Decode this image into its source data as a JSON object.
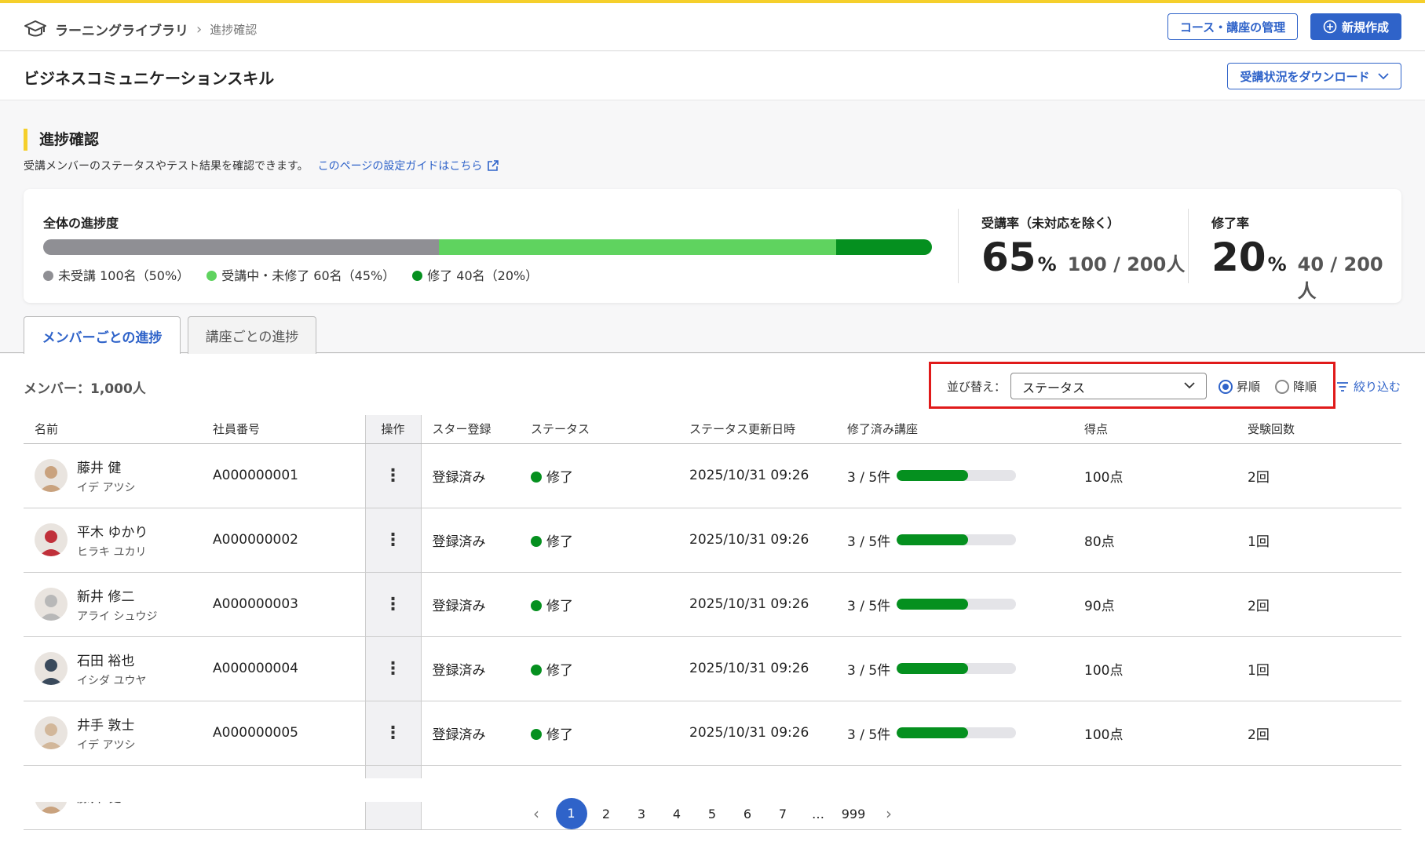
{
  "header": {
    "library": "ラーニングライブラリ",
    "current": "進捗確認",
    "manage_button": "コース・講座の管理",
    "new_button": "新規作成"
  },
  "course": {
    "title": "ビジネスコミュニケーションスキル",
    "download_button": "受講状況をダウンロード"
  },
  "section": {
    "title": "進捗確認",
    "description": "受講メンバーのステータスやテスト結果を確認できます。",
    "guide_link": "このページの設定ガイドはこちら"
  },
  "overview": {
    "progress_label": "全体の進捗度",
    "segments": [
      {
        "label": "未受講 100名（50%）",
        "fraction": 0.445,
        "color": "#8f8f94"
      },
      {
        "label": "受講中・未修了 60名（45%）",
        "fraction": 0.447,
        "color": "#5fd35f"
      },
      {
        "label": "修了 40名（20%）",
        "fraction": 0.108,
        "color": "#05901f"
      }
    ],
    "attendance": {
      "label": "受講率（未対応を除く）",
      "percent": "65",
      "unit": "%",
      "count": "100 / 200人"
    },
    "completion": {
      "label": "修了率",
      "percent": "20",
      "unit": "%",
      "count": "40 / 200人"
    }
  },
  "tabs": {
    "members": "メンバーごとの進捗",
    "courses": "講座ごとの進捗"
  },
  "list": {
    "member_count": "メンバー：1,000人",
    "sort_label": "並び替え：",
    "sort_value": "ステータス",
    "asc": "昇順",
    "desc": "降順",
    "filter": "絞り込む"
  },
  "table": {
    "headers": [
      "名前",
      "社員番号",
      "操作",
      "スター登録",
      "ステータス",
      "ステータス更新日時",
      "修了済み講座",
      "得点",
      "受験回数"
    ],
    "rows": [
      {
        "name": "藤井 健",
        "kana": "イデ アツシ",
        "id": "A000000001",
        "star": "登録済み",
        "status": "修了",
        "updated": "2025/10/31 09:26",
        "completed": "3 / 5件",
        "progress": 0.6,
        "score": "100点",
        "attempts": "2回",
        "avatar_color": "#c9a27e"
      },
      {
        "name": "平木 ゆかり",
        "kana": "ヒラキ ユカリ",
        "id": "A000000002",
        "star": "登録済み",
        "status": "修了",
        "updated": "2025/10/31 09:26",
        "completed": "3 / 5件",
        "progress": 0.6,
        "score": "80点",
        "attempts": "1回",
        "avatar_color": "#c0303a"
      },
      {
        "name": "新井 修二",
        "kana": "アライ シュウジ",
        "id": "A000000003",
        "star": "登録済み",
        "status": "修了",
        "updated": "2025/10/31 09:26",
        "completed": "3 / 5件",
        "progress": 0.6,
        "score": "90点",
        "attempts": "2回",
        "avatar_color": "#b8b8b8"
      },
      {
        "name": "石田 裕也",
        "kana": "イシダ ユウヤ",
        "id": "A000000004",
        "star": "登録済み",
        "status": "修了",
        "updated": "2025/10/31 09:26",
        "completed": "3 / 5件",
        "progress": 0.6,
        "score": "100点",
        "attempts": "1回",
        "avatar_color": "#3a4a5c"
      },
      {
        "name": "井手 敦士",
        "kana": "イデ アツシ",
        "id": "A000000005",
        "star": "登録済み",
        "status": "修了",
        "updated": "2025/10/31 09:26",
        "completed": "3 / 5件",
        "progress": 0.6,
        "score": "100点",
        "attempts": "2回",
        "avatar_color": "#d2b79a"
      },
      {
        "name": "藤井 健",
        "kana": "",
        "id": "",
        "star": "",
        "status": "",
        "updated": "",
        "completed": "",
        "progress": 0,
        "score": "",
        "attempts": "",
        "avatar_color": "#c9a27e"
      }
    ]
  },
  "pagination": {
    "prev": "‹",
    "pages": [
      "1",
      "2",
      "3",
      "4",
      "5",
      "6",
      "7",
      "…",
      "999"
    ],
    "current": "1",
    "next": "›"
  }
}
